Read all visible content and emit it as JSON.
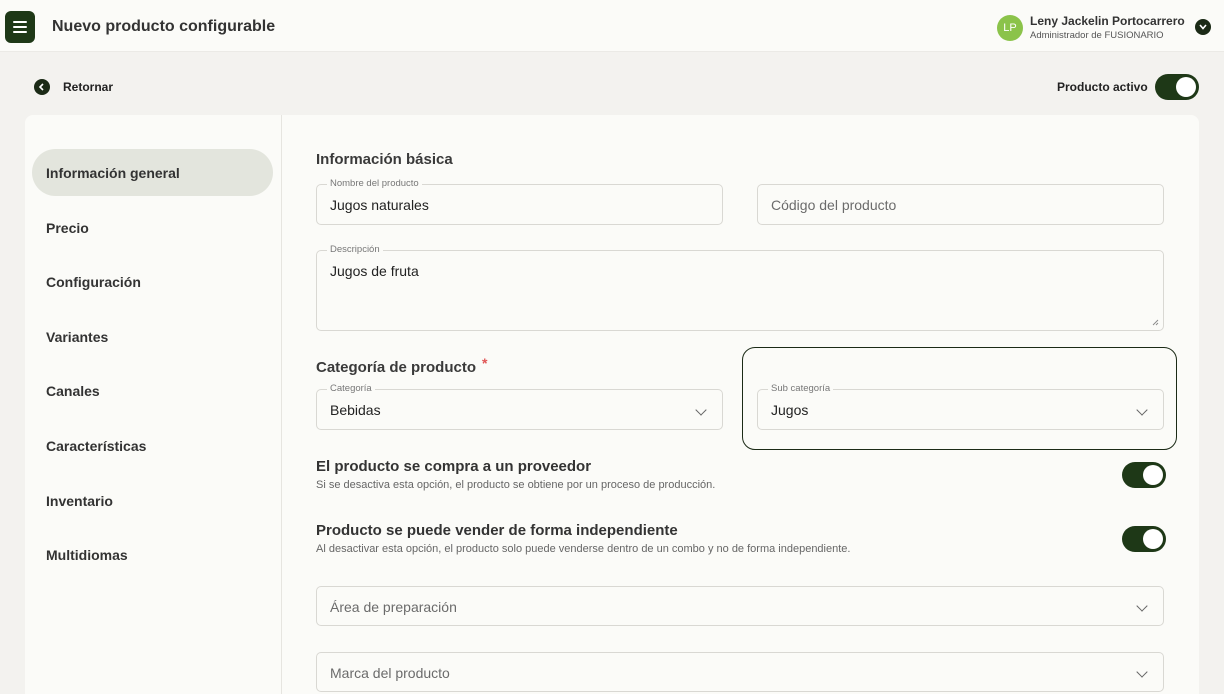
{
  "header": {
    "title": "Nuevo producto configurable",
    "avatar_initials": "LP",
    "user_name": "Leny Jackelin Portocarrero",
    "user_role": "Administrador de FUSIONARIO"
  },
  "toolbar": {
    "back_label": "Retornar",
    "active_label": "Producto activo",
    "active_on": true
  },
  "sidebar": {
    "items": [
      {
        "label": "Información general",
        "active": true
      },
      {
        "label": "Precio",
        "active": false
      },
      {
        "label": "Configuración",
        "active": false
      },
      {
        "label": "Variantes",
        "active": false
      },
      {
        "label": "Canales",
        "active": false
      },
      {
        "label": "Características",
        "active": false
      },
      {
        "label": "Inventario",
        "active": false
      },
      {
        "label": "Multidiomas",
        "active": false
      }
    ]
  },
  "basic": {
    "title": "Información básica",
    "name_label": "Nombre del producto",
    "name_value": "Jugos naturales",
    "code_placeholder": "Código del producto",
    "desc_label": "Descripción",
    "desc_value": "Jugos de fruta"
  },
  "category": {
    "title": "Categoría de producto",
    "required_mark": "*",
    "cat_label": "Categoría",
    "cat_value": "Bebidas",
    "subcat_label": "Sub categoría",
    "subcat_value": "Jugos"
  },
  "options": {
    "supplier_title": "El producto se compra a un proveedor",
    "supplier_desc": "Si se desactiva esta opción, el producto se obtiene por un proceso de producción.",
    "supplier_on": true,
    "standalone_title": "Producto se puede vender de forma independiente",
    "standalone_desc": "Al desactivar esta opción, el producto solo puede venderse dentro de un combo y no de forma independiente.",
    "standalone_on": true
  },
  "extra": {
    "prep_area_placeholder": "Área de preparación",
    "brand_placeholder": "Marca del producto"
  },
  "colors": {
    "accent": "#1e3817",
    "avatar": "#8bc34a",
    "active_nav": "#e3e5dd",
    "required": "#e05555"
  }
}
